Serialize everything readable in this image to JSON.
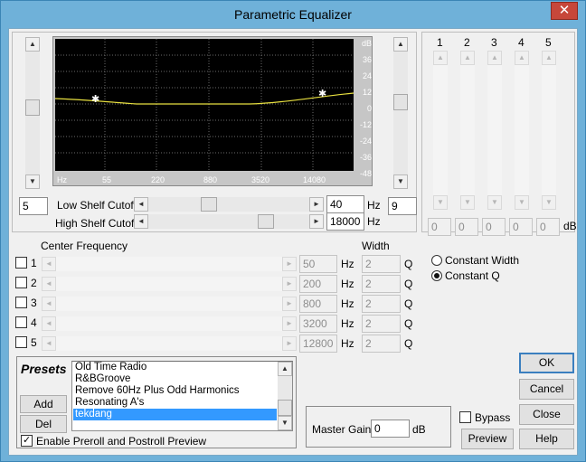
{
  "window": {
    "title": "Parametric Equalizer",
    "close_glyph": "✕"
  },
  "graph": {
    "db_labels": [
      "dB",
      "36",
      "24",
      "12",
      "0",
      "-12",
      "-24",
      "-36",
      "-48"
    ],
    "freq_labels": [
      "Hz",
      "55",
      "220",
      "880",
      "3520",
      "14080"
    ]
  },
  "left_field": "5",
  "right_field": "9",
  "shelf": {
    "low_label": "Low Shelf Cutoff",
    "low_value": "40",
    "low_unit": "Hz",
    "high_label": "High Shelf Cutoff",
    "high_value": "18000",
    "high_unit": "Hz"
  },
  "bands": {
    "numbers": [
      "1",
      "2",
      "3",
      "4",
      "5"
    ],
    "values": [
      "0",
      "0",
      "0",
      "0",
      "0"
    ],
    "unit": "dB"
  },
  "center_freq": {
    "header": "Center Frequency",
    "width_header": "Width",
    "rows": [
      {
        "num": "1",
        "freq": "50",
        "hz": "Hz",
        "width": "2",
        "q": "Q"
      },
      {
        "num": "2",
        "freq": "200",
        "hz": "Hz",
        "width": "2",
        "q": "Q"
      },
      {
        "num": "3",
        "freq": "800",
        "hz": "Hz",
        "width": "2",
        "q": "Q"
      },
      {
        "num": "4",
        "freq": "3200",
        "hz": "Hz",
        "width": "2",
        "q": "Q"
      },
      {
        "num": "5",
        "freq": "12800",
        "hz": "Hz",
        "width": "2",
        "q": "Q"
      }
    ]
  },
  "mode": {
    "constant_width": "Constant Width",
    "constant_q": "Constant Q",
    "selected": "constant_q"
  },
  "presets": {
    "title": "Presets",
    "items": [
      "Old Time Radio",
      "R&BGroove",
      "Remove 60Hz Plus Odd Harmonics",
      "Resonating A's",
      "tekdang"
    ],
    "selected": "tekdang",
    "add_label": "Add",
    "del_label": "Del",
    "preroll_label": "Enable Preroll and Postroll Preview"
  },
  "master_gain": {
    "label": "Master Gain",
    "value": "0",
    "unit": "dB"
  },
  "bypass_label": "Bypass",
  "buttons": {
    "ok": "OK",
    "cancel": "Cancel",
    "close": "Close",
    "help": "Help",
    "preview": "Preview"
  },
  "arrows": {
    "up": "▲",
    "down": "▼",
    "left": "◄",
    "right": "►"
  }
}
